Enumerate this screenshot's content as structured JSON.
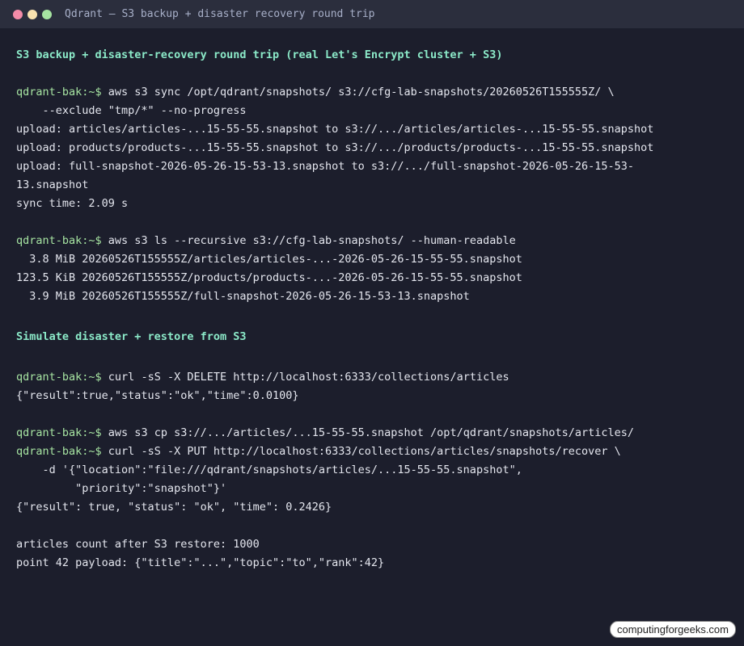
{
  "window": {
    "title": "Qdrant — S3 backup + disaster recovery round trip",
    "controls": {
      "close": "#f38ba8",
      "minimize": "#f9e2af",
      "maximize": "#a6e3a1"
    }
  },
  "terminal": {
    "prompt": "qdrant-bak:~$",
    "heading1": "S3 backup + disaster-recovery round trip (real Let's Encrypt cluster + S3)",
    "cmd1": " aws s3 sync /opt/qdrant/snapshots/ s3://cfg-lab-snapshots/20260526T155555Z/ \\",
    "cmd1_cont": "    --exclude \"tmp/*\" --no-progress",
    "out1": [
      "upload: articles/articles-...15-55-55.snapshot to s3://.../articles/articles-...15-55-55.snapshot",
      "upload: products/products-...15-55-55.snapshot to s3://.../products/products-...15-55-55.snapshot",
      "upload: full-snapshot-2026-05-26-15-53-13.snapshot to s3://.../full-snapshot-2026-05-26-15-53-",
      "13.snapshot",
      "sync time: 2.09 s"
    ],
    "cmd2": " aws s3 ls --recursive s3://cfg-lab-snapshots/ --human-readable",
    "out2": [
      "  3.8 MiB 20260526T155555Z/articles/articles-...-2026-05-26-15-55-55.snapshot",
      "123.5 KiB 20260526T155555Z/products/products-...-2026-05-26-15-55-55.snapshot",
      "  3.9 MiB 20260526T155555Z/full-snapshot-2026-05-26-15-53-13.snapshot"
    ],
    "heading2": "Simulate disaster + restore from S3",
    "cmd3": " curl -sS -X DELETE http://localhost:6333/collections/articles",
    "out3": "{\"result\":true,\"status\":\"ok\",\"time\":0.0100}",
    "cmd4": " aws s3 cp s3://.../articles/...15-55-55.snapshot /opt/qdrant/snapshots/articles/",
    "cmd5": " curl -sS -X PUT http://localhost:6333/collections/articles/snapshots/recover \\",
    "cmd5_cont1": "    -d '{\"location\":\"file:///qdrant/snapshots/articles/...15-55-55.snapshot\",",
    "cmd5_cont2": "         \"priority\":\"snapshot\"}'",
    "out5": "{\"result\": true, \"status\": \"ok\", \"time\": 0.2426}",
    "out6": [
      "articles count after S3 restore: 1000",
      "point 42 payload: {\"title\":\"...\",\"topic\":\"to\",\"rank\":42}"
    ]
  },
  "watermark": "computingforgeeks.com"
}
